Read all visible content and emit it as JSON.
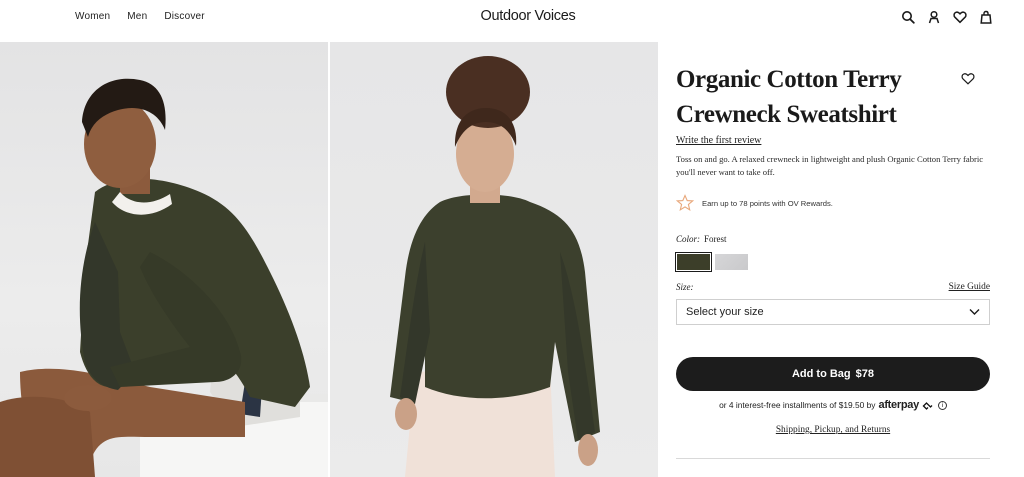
{
  "header": {
    "nav": [
      "Women",
      "Men",
      "Discover"
    ],
    "logo": "Outdoor Voices",
    "icons": [
      "search-icon",
      "account-icon",
      "wishlist-icon",
      "bag-icon"
    ]
  },
  "gallery": {
    "images": [
      "male-model-sitting-forest-sweatshirt",
      "female-model-standing-forest-sweatshirt"
    ]
  },
  "product": {
    "title": "Organic Cotton Terry Crewneck Sweatshirt",
    "review_link": "Write the first review",
    "description": "Toss on and go. A relaxed crewneck in lightweight and plush Organic Cotton Terry fabric you'll never want to take off.",
    "rewards": "Earn up to 78 points with OV Rewards.",
    "color_label": "Color:",
    "color_value": "Forest",
    "swatches": [
      {
        "name": "Forest",
        "hex": "#3c3e29",
        "selected": true
      },
      {
        "name": "Grey",
        "hex": "#d0d0d2",
        "selected": false
      }
    ],
    "size_label": "Size:",
    "size_guide": "Size Guide",
    "size_placeholder": "Select your size",
    "add_to_bag": "Add to Bag",
    "price": "$78",
    "afterpay_text": "or 4 interest-free installments of $19.50 by",
    "afterpay_brand": "afterpay",
    "afterpay_info": "i",
    "shipping_link": "Shipping, Pickup, and Returns"
  },
  "colors": {
    "button_bg": "#1c1c1c",
    "forest": "#3c3e29",
    "reward_star": "#e8a87c"
  }
}
